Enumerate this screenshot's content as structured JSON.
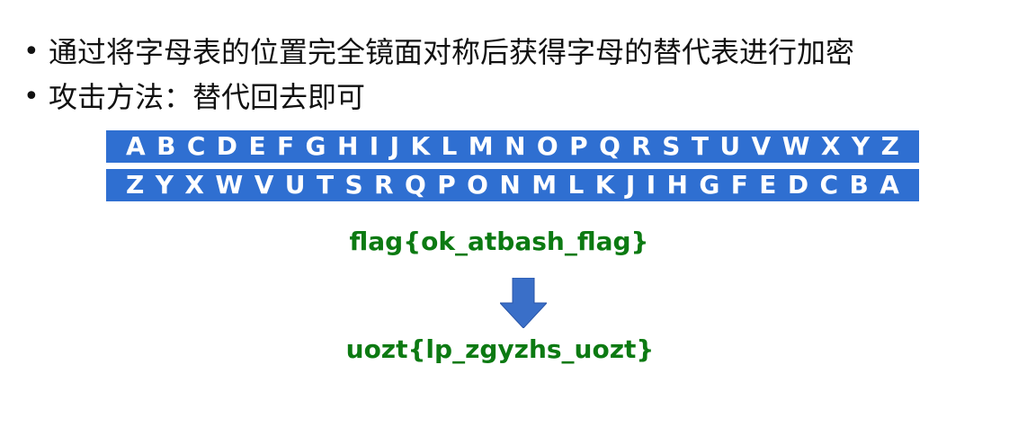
{
  "bullets": [
    {
      "symbol": "•",
      "text": "通过将字母表的位置完全镜面对称后获得字母的替代表进行加密"
    },
    {
      "symbol": "•",
      "text": "攻击方法：替代回去即可"
    }
  ],
  "alphabet": {
    "plain": "ABCDEFGHIJKLMNOPQRSTUVWXYZ",
    "cipher": "ZYXWVUTSRQPONMLKJIHGFEDCBA"
  },
  "example": {
    "plaintext": "flag{ok_atbash_flag}",
    "ciphertext": "uozt{lp_zgyzhs_uozt}"
  },
  "icons": {
    "arrow": "arrow-down-icon"
  },
  "colors": {
    "bar": "#2f6fd1",
    "flag_text": "#0c7a12",
    "arrow": "#3a6fc8"
  }
}
